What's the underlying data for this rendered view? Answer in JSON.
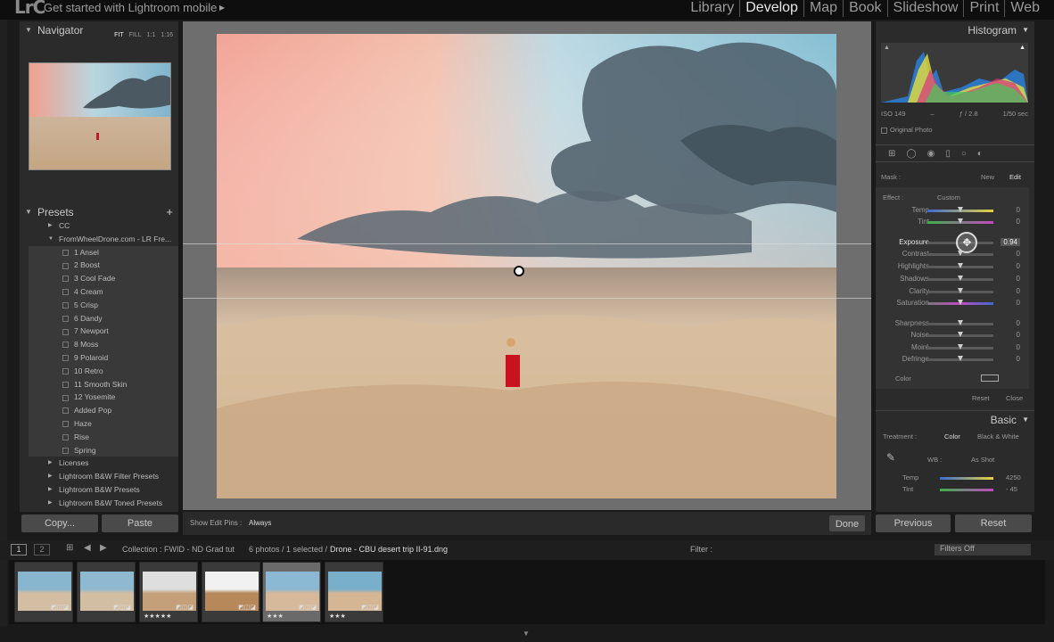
{
  "app": {
    "logo": "LrC",
    "mobile_prompt": "Get started with Lightroom mobile"
  },
  "modules": [
    "Library",
    "Develop",
    "Map",
    "Book",
    "Slideshow",
    "Print",
    "Web"
  ],
  "active_module": "Develop",
  "navigator": {
    "title": "Navigator",
    "zoom_options": [
      "FIT",
      "FILL",
      "1:1",
      "1:16"
    ]
  },
  "presets": {
    "title": "Presets",
    "items": [
      {
        "type": "folder",
        "label": "CC",
        "open": false
      },
      {
        "type": "folder",
        "label": "FromWheelDrone.com - LR Fre...",
        "open": true
      },
      {
        "type": "preset",
        "label": "1 Ansel"
      },
      {
        "type": "preset",
        "label": "2 Boost"
      },
      {
        "type": "preset",
        "label": "3 Cool Fade"
      },
      {
        "type": "preset",
        "label": "4 Cream"
      },
      {
        "type": "preset",
        "label": "5 Crisp"
      },
      {
        "type": "preset",
        "label": "6 Dandy"
      },
      {
        "type": "preset",
        "label": "7 Newport"
      },
      {
        "type": "preset",
        "label": "8 Moss"
      },
      {
        "type": "preset",
        "label": "9 Polaroid"
      },
      {
        "type": "preset",
        "label": "10 Retro"
      },
      {
        "type": "preset",
        "label": "11 Smooth Skin"
      },
      {
        "type": "preset",
        "label": "12 Yosemite"
      },
      {
        "type": "preset",
        "label": "Added Pop"
      },
      {
        "type": "preset",
        "label": "Haze"
      },
      {
        "type": "preset",
        "label": "Rise"
      },
      {
        "type": "preset",
        "label": "Spring"
      },
      {
        "type": "folder",
        "label": "Licenses",
        "open": false
      },
      {
        "type": "folder",
        "label": "Lightroom B&W Filter Presets",
        "open": false
      },
      {
        "type": "folder",
        "label": "Lightroom B&W Presets",
        "open": false
      },
      {
        "type": "folder",
        "label": "Lightroom B&W Toned Presets",
        "open": false
      }
    ]
  },
  "left_buttons": {
    "copy": "Copy...",
    "paste": "Paste"
  },
  "toolbar": {
    "pins_label": "Show Edit Pins :",
    "pins_value": "Always",
    "done": "Done"
  },
  "histogram": {
    "title": "Histogram",
    "iso": "ISO 149",
    "focal": "–",
    "aperture": "ƒ / 2.8",
    "shutter": "1/50 sec",
    "original_photo": "Original Photo"
  },
  "mask": {
    "label": "Mask :",
    "new": "New",
    "edit": "Edit"
  },
  "effect": {
    "label": "Effect :",
    "value": "Custom"
  },
  "sliders": [
    {
      "label": "Temp",
      "value": "0",
      "pos": 0.5
    },
    {
      "label": "Tint",
      "value": "0",
      "pos": 0.5
    },
    {
      "label": "Exposure",
      "value": "0.94",
      "pos": 0.6,
      "active": true
    },
    {
      "label": "Contrast",
      "value": "0",
      "pos": 0.5
    },
    {
      "label": "Highlights",
      "value": "0",
      "pos": 0.5
    },
    {
      "label": "Shadows",
      "value": "0",
      "pos": 0.5
    },
    {
      "label": "Clarity",
      "value": "0",
      "pos": 0.5
    },
    {
      "label": "Saturation",
      "value": "0",
      "pos": 0.5
    },
    {
      "label": "Sharpness",
      "value": "0",
      "pos": 0.5
    },
    {
      "label": "Noise",
      "value": "0",
      "pos": 0.5
    },
    {
      "label": "Moiré",
      "value": "0",
      "pos": 0.5
    },
    {
      "label": "Defringe",
      "value": "0",
      "pos": 0.5
    }
  ],
  "color_label": "Color",
  "mask_actions": {
    "reset": "Reset",
    "close": "Close"
  },
  "basic": {
    "title": "Basic",
    "treatment_label": "Treatment :",
    "color": "Color",
    "bw": "Black & White",
    "wb_label": "WB :",
    "wb_value": "As Shot",
    "temp_label": "Temp",
    "temp_value": "4250",
    "tint_label": "Tint",
    "tint_value": "- 45"
  },
  "right_buttons": {
    "previous": "Previous",
    "reset": "Reset"
  },
  "filmbar": {
    "page1": "1",
    "page2": "2",
    "collection": "Collection : FWID - ND Grad tut",
    "count": "6 photos / 1 selected /",
    "filename": "Drone - CBU desert trip II-91.dng",
    "filter_label": "Filter :",
    "filters_off": "Filters Off"
  },
  "thumbnails": [
    {
      "stars": "",
      "selected": false
    },
    {
      "stars": "",
      "selected": false
    },
    {
      "stars": "★★★★★",
      "selected": false
    },
    {
      "stars": "",
      "selected": false
    },
    {
      "stars": "★★★",
      "selected": true
    },
    {
      "stars": "★★★",
      "selected": false
    }
  ]
}
